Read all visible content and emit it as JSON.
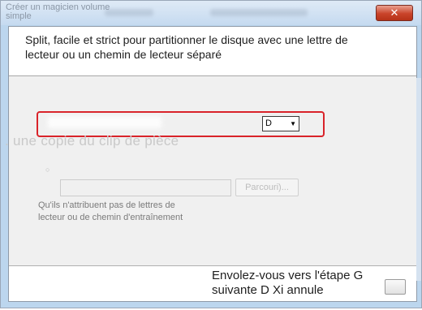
{
  "window": {
    "title": "Créer un magicien volume simple",
    "close_symbol": "✕"
  },
  "header": {
    "description": "Split, facile et strict pour partitionner le disque avec une lettre de lecteur ou un chemin de lecteur séparé"
  },
  "drive_letter": {
    "selected": "D",
    "arrow": "▼"
  },
  "overlay_caption": ". une copie du clip de pièce",
  "mount_option": {
    "radio_symbol": "○",
    "path_value": "",
    "browse_label": "Parcouri)..."
  },
  "no_letter_option": {
    "label": "Qu'ils n'attribuent pas de lettres de lecteur ou de chemin d'entraînement"
  },
  "footer": {
    "caption": "Envolez-vous vers l'étape G suivante D Xi annule"
  }
}
